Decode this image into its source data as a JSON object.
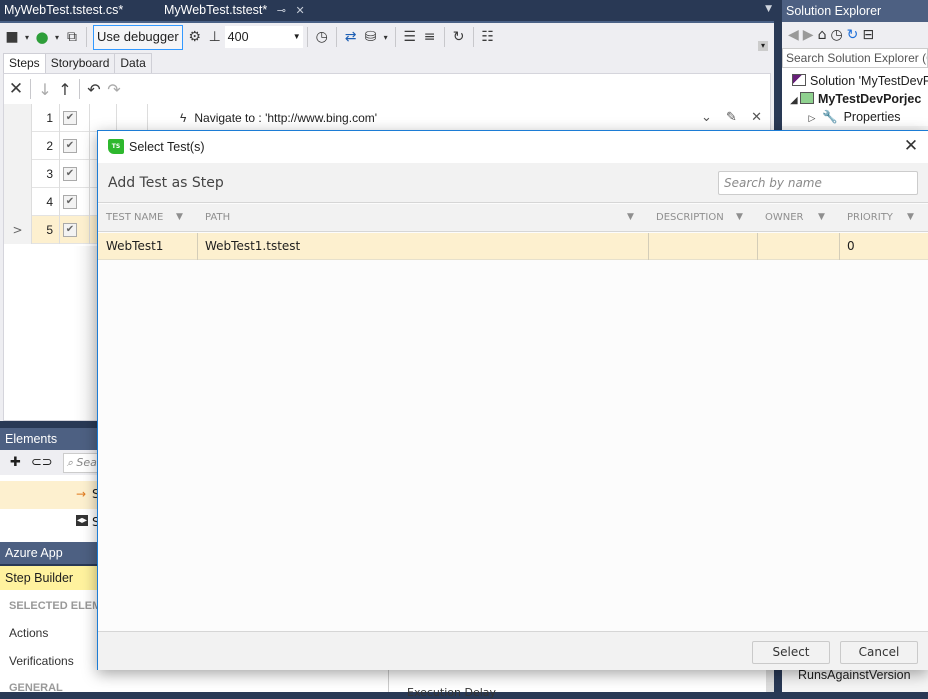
{
  "document_tabs": [
    {
      "label": "MyWebTest.tstest.cs*",
      "active": false
    },
    {
      "label": "MyWebTest.tstest*",
      "active": true,
      "pin_icon": "pin-icon",
      "close_icon": "close-icon"
    }
  ],
  "toolbar": {
    "record_icon": "video-camera-icon",
    "run_icon": "play-icon",
    "run_in_window_icon": "window-arrow-icon",
    "use_debugger_label": "Use debugger",
    "settings_icon": "gear-icon",
    "delay_icon": "delay-icon",
    "delay_value": "400",
    "clock_icon": "clock-icon",
    "sync_icon": "sync-icon",
    "database_icon": "database-icon",
    "edit_list_icon": "edit-list-icon",
    "outline_icon": "outline-icon",
    "refresh_icon": "refresh-icon",
    "list_icon": "list-icon"
  },
  "sub_tabs": [
    {
      "label": "Steps",
      "active": true
    },
    {
      "label": "Storyboard",
      "active": false
    },
    {
      "label": "Data",
      "active": false
    }
  ],
  "steps": {
    "toolbar_icons": [
      "delete-icon",
      "move-down-icon",
      "move-up-icon",
      "undo-icon",
      "redo-icon"
    ],
    "rows": [
      {
        "number": "1",
        "checked": true,
        "description": "Navigate to : 'http://www.bing.com'",
        "selected": false
      },
      {
        "number": "2",
        "checked": true,
        "description": "",
        "selected": false
      },
      {
        "number": "3",
        "checked": true,
        "description": "",
        "selected": false
      },
      {
        "number": "4",
        "checked": true,
        "description": "",
        "selected": false
      },
      {
        "number": "5",
        "checked": true,
        "description": "",
        "selected": true,
        "gutter": ">"
      }
    ]
  },
  "elements_explorer": {
    "title": "Elements Explorer",
    "search_placeholder": "Search",
    "rows": [
      {
        "icon": "arrow-right-icon",
        "label": "S",
        "selected": true
      },
      {
        "icon": "element-icon",
        "label": "S",
        "selected": false
      }
    ]
  },
  "azure_pane": {
    "title": "Azure App Service"
  },
  "step_builder": {
    "title": "Step Builder",
    "section_selected": "SELECTED ELEME",
    "items": [
      "Actions",
      "Verifications"
    ],
    "section_general": "GENERAL",
    "execution_delay": "Execution Delay"
  },
  "solution_explorer": {
    "title": "Solution Explorer",
    "search_placeholder": "Search Solution Explorer (C",
    "tree": [
      {
        "label": "Solution 'MyTestDevP",
        "bold": false,
        "expander": "",
        "icon": "solution-icon"
      },
      {
        "label": "MyTestDevPorjec",
        "bold": true,
        "expander": "◢",
        "icon": "test-project-icon"
      },
      {
        "label": "Properties",
        "bold": false,
        "expander": "▷",
        "icon": "wrench-icon"
      }
    ],
    "bottom_item": "RunsAgainstVersion"
  },
  "dialog": {
    "title": "Select Test(s)",
    "logo_text": "TS",
    "heading": "Add Test as Step",
    "search_placeholder": "Search by name",
    "columns": [
      {
        "label": "TEST NAME"
      },
      {
        "label": "PATH"
      },
      {
        "label": "DESCRIPTION"
      },
      {
        "label": "OWNER"
      },
      {
        "label": "PRIORITY"
      }
    ],
    "rows": [
      {
        "test_name": "WebTest1",
        "path": "WebTest1.tstest",
        "description": "",
        "owner": "",
        "priority": "0",
        "selected": true
      }
    ],
    "select_label": "Select",
    "cancel_label": "Cancel"
  },
  "colors": {
    "ide_chrome": "#293955",
    "pane_title": "#4d6082",
    "selection": "#fdf0cf",
    "step_builder_highlight": "#fff29e",
    "dialog_border": "#1c7cd5",
    "logo_green": "#2eb82e"
  }
}
